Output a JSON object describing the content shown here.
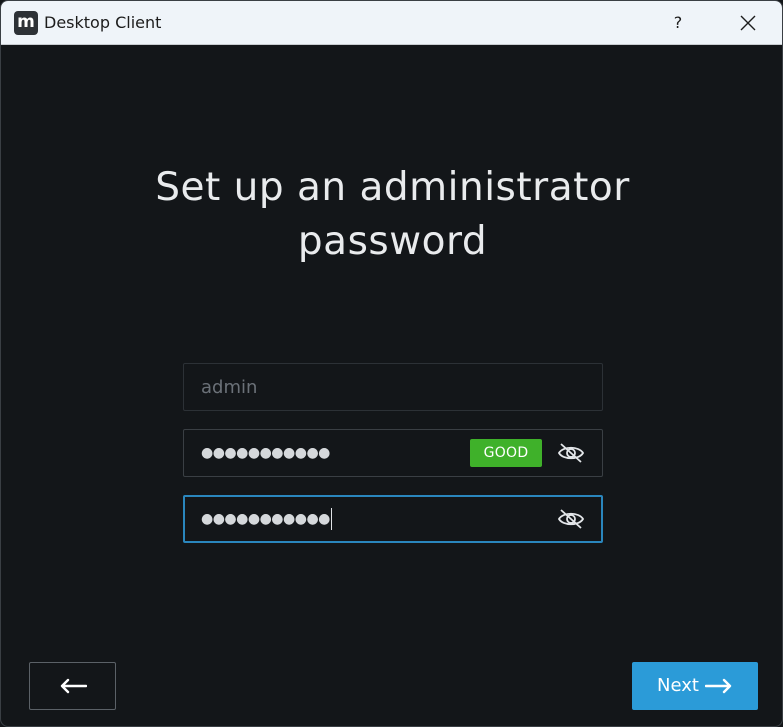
{
  "window": {
    "title": "Desktop Client",
    "app_icon_letter": "m",
    "help_label": "?"
  },
  "main": {
    "heading": "Set up an administrator password",
    "username_field": {
      "value": "",
      "placeholder": "admin"
    },
    "password_field": {
      "masked_value": "●●●●●●●●●●●",
      "strength_label": "GOOD",
      "strength_color": "#3fb12a",
      "toggle_icon": "eye-off-icon"
    },
    "confirm_field": {
      "masked_value": "●●●●●●●●●●●",
      "focused": true,
      "focus_color": "#2a86bd",
      "toggle_icon": "eye-off-icon"
    }
  },
  "footer": {
    "back_icon": "arrow-left-icon",
    "next_label": "Next",
    "next_icon": "arrow-right-icon",
    "accent_color": "#2b9bd8"
  }
}
